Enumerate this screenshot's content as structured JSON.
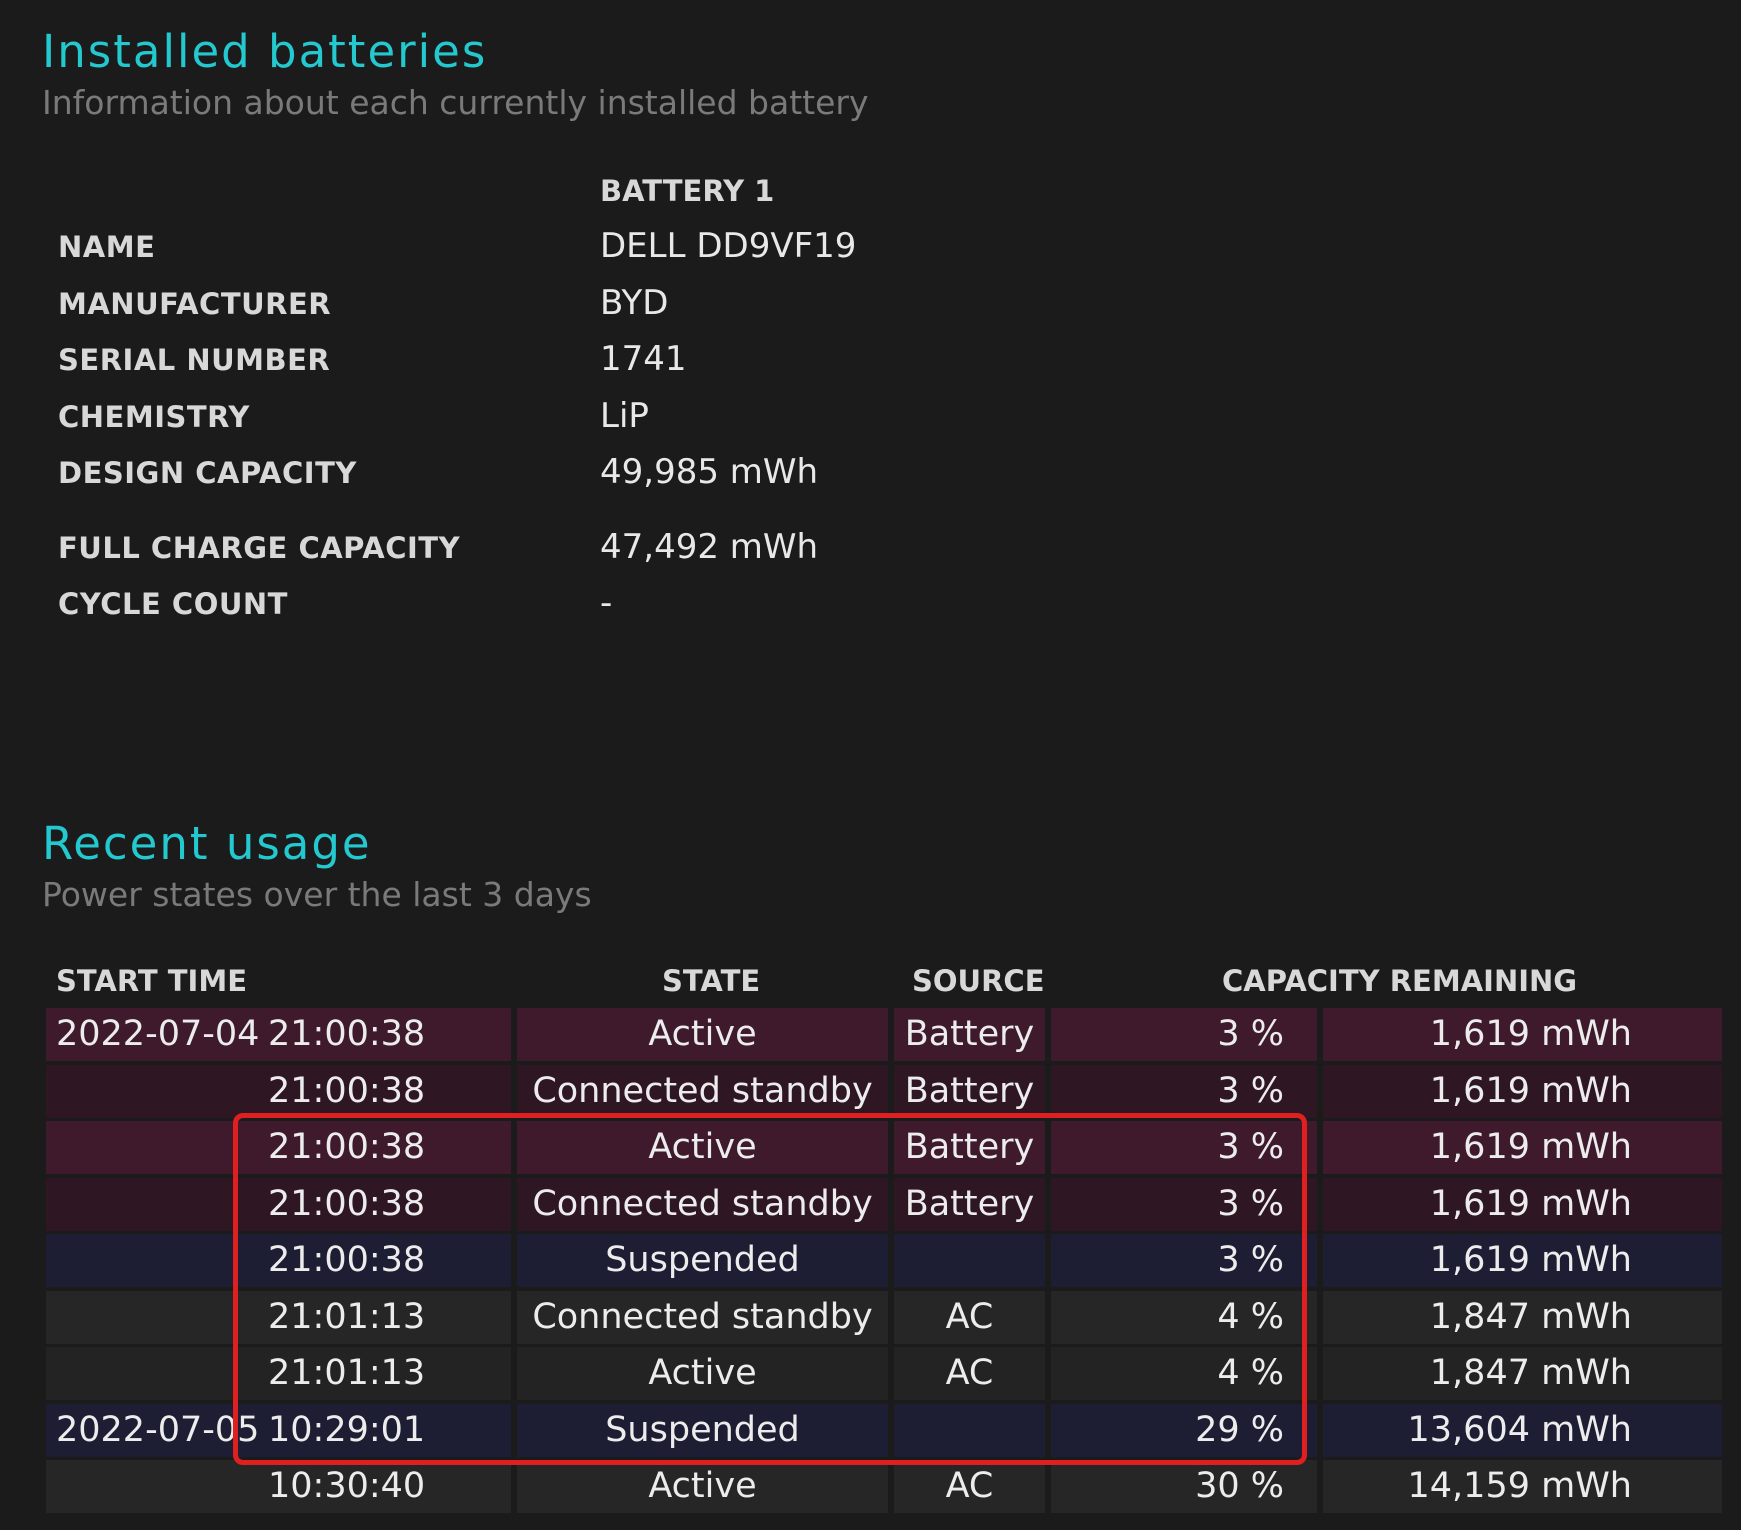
{
  "installed": {
    "title": "Installed batteries",
    "subtitle": "Information about each currently installed battery",
    "column_header": "BATTERY 1",
    "rows": [
      {
        "label": "NAME",
        "value": "DELL DD9VF19"
      },
      {
        "label": "MANUFACTURER",
        "value": "BYD"
      },
      {
        "label": "SERIAL NUMBER",
        "value": "1741"
      },
      {
        "label": "CHEMISTRY",
        "value": "LiP"
      },
      {
        "label": "DESIGN CAPACITY",
        "value": "49,985 mWh"
      },
      {
        "label": "FULL CHARGE CAPACITY",
        "value": "47,492 mWh"
      },
      {
        "label": "CYCLE COUNT",
        "value": "-"
      }
    ]
  },
  "recent": {
    "title": "Recent usage",
    "subtitle": "Power states over the last 3 days",
    "headers": {
      "start_time": "START TIME",
      "state": "STATE",
      "source": "SOURCE",
      "capacity_remaining": "CAPACITY REMAINING"
    },
    "rows": [
      {
        "date": "2022-07-04",
        "time": "21:00:38",
        "state": "Active",
        "source": "Battery",
        "percent": "3 %",
        "mwh": "1,619 mWh",
        "theme": "active"
      },
      {
        "date": "",
        "time": "21:00:38",
        "state": "Connected standby",
        "source": "Battery",
        "percent": "3 %",
        "mwh": "1,619 mWh",
        "theme": "cs"
      },
      {
        "date": "",
        "time": "21:00:38",
        "state": "Active",
        "source": "Battery",
        "percent": "3 %",
        "mwh": "1,619 mWh",
        "theme": "active"
      },
      {
        "date": "",
        "time": "21:00:38",
        "state": "Connected standby",
        "source": "Battery",
        "percent": "3 %",
        "mwh": "1,619 mWh",
        "theme": "cs"
      },
      {
        "date": "",
        "time": "21:00:38",
        "state": "Suspended",
        "source": "",
        "percent": "3 %",
        "mwh": "1,619 mWh",
        "theme": "susp"
      },
      {
        "date": "",
        "time": "21:01:13",
        "state": "Connected standby",
        "source": "AC",
        "percent": "4 %",
        "mwh": "1,847 mWh",
        "theme": "ac"
      },
      {
        "date": "",
        "time": "21:01:13",
        "state": "Active",
        "source": "AC",
        "percent": "4 %",
        "mwh": "1,847 mWh",
        "theme": "ac2"
      },
      {
        "date": "2022-07-05",
        "time": "10:29:01",
        "state": "Suspended",
        "source": "",
        "percent": "29 %",
        "mwh": "13,604 mWh",
        "theme": "susp"
      },
      {
        "date": "",
        "time": "10:30:40",
        "state": "Active",
        "source": "AC",
        "percent": "30 %",
        "mwh": "14,159 mWh",
        "theme": "ac"
      }
    ]
  },
  "colors": {
    "accent": "#24c9cf",
    "highlight": "#e02020"
  }
}
